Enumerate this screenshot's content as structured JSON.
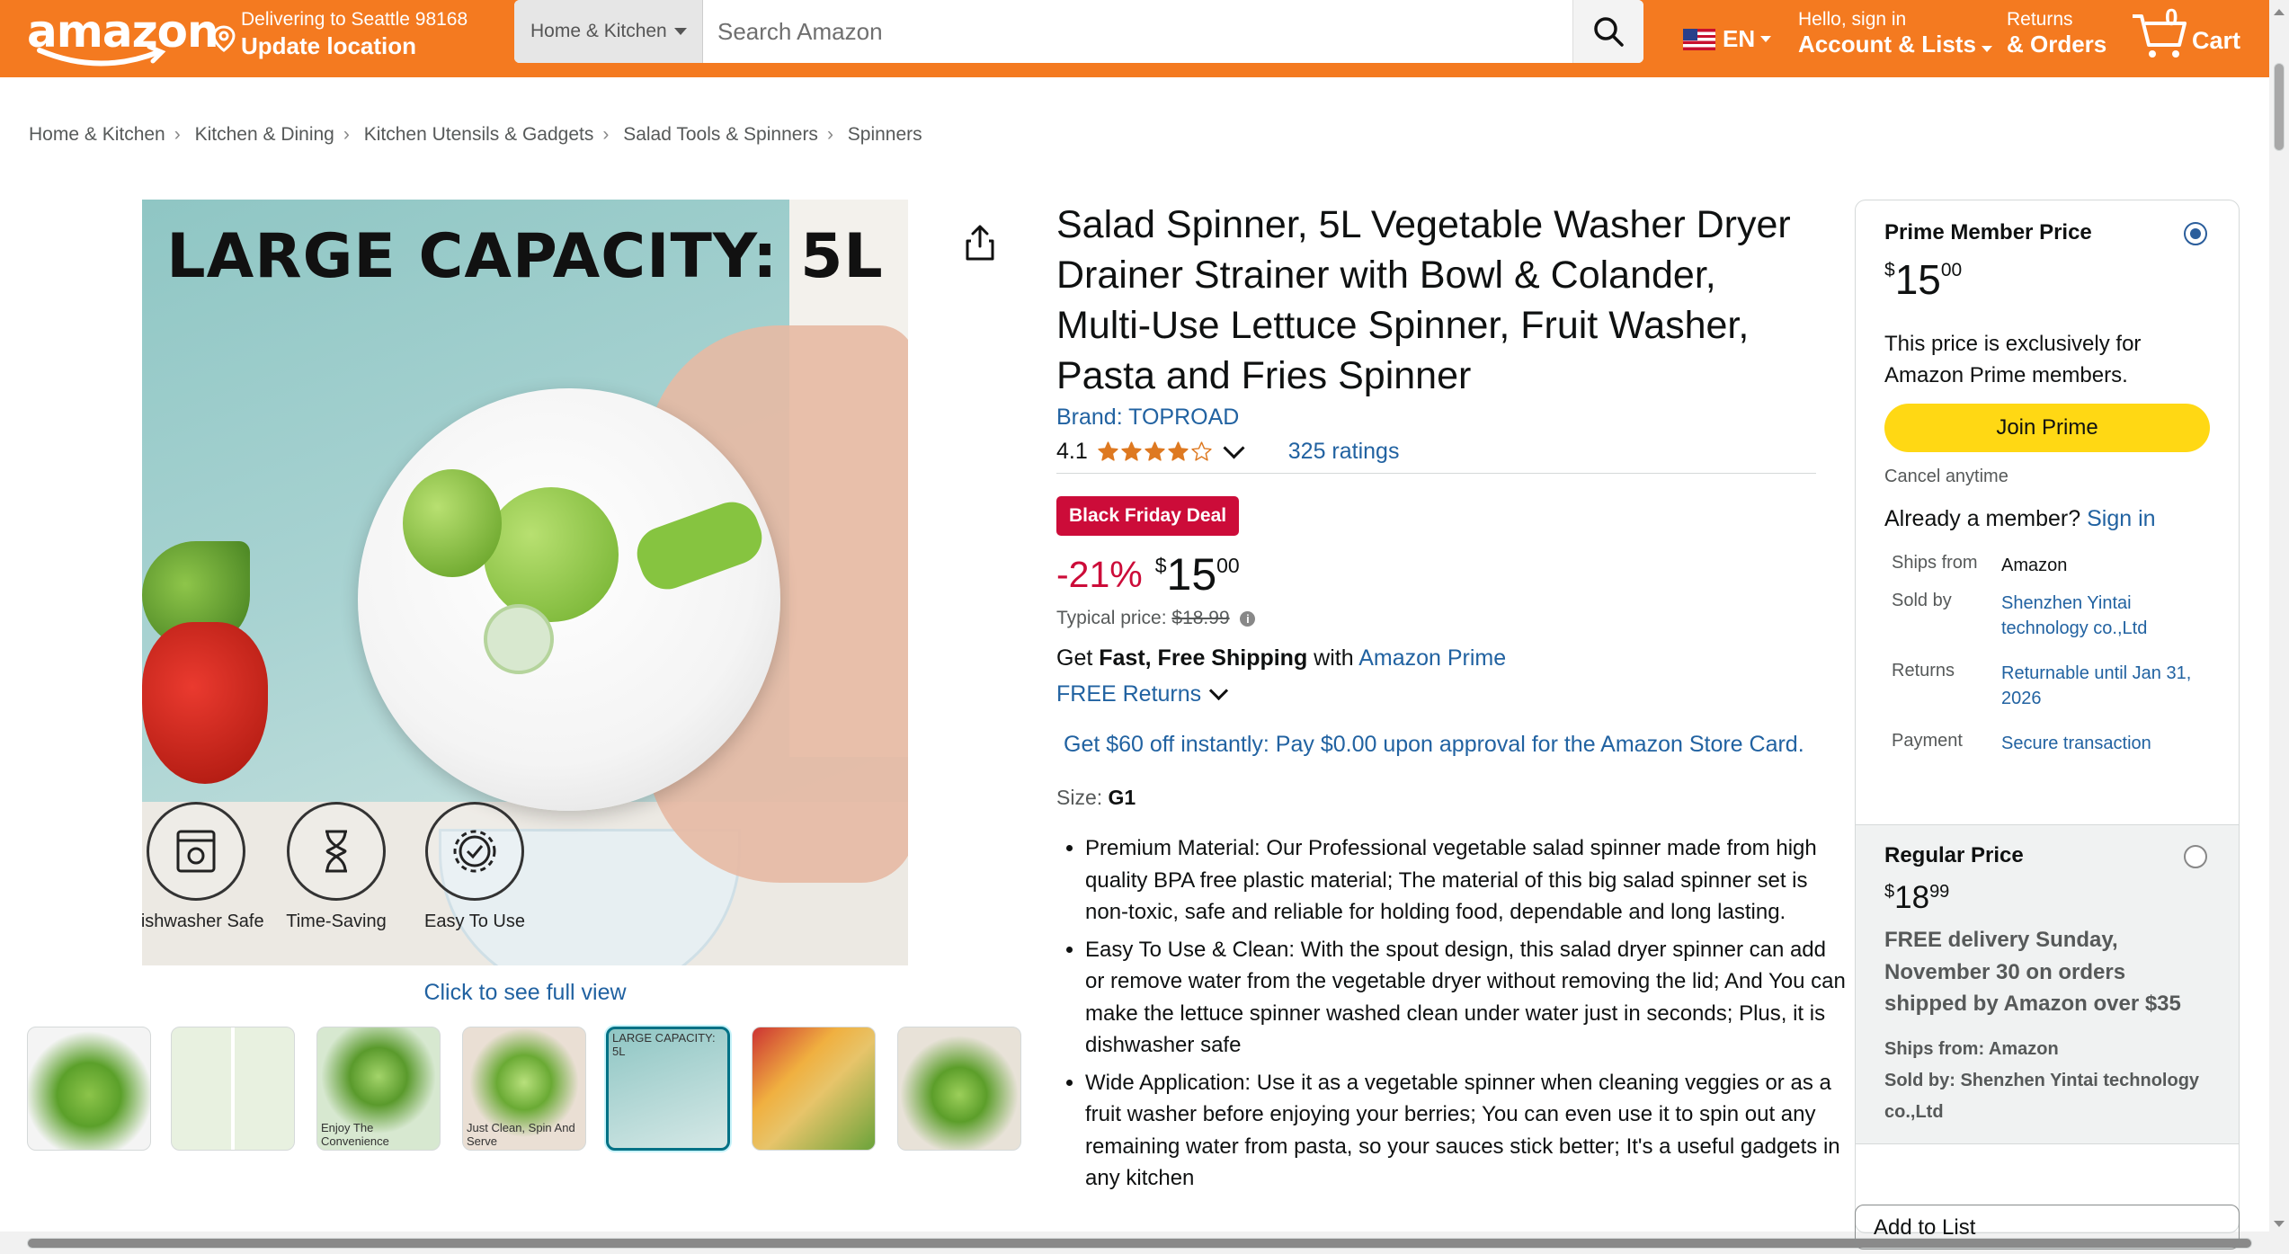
{
  "nav": {
    "logo": "amazon",
    "deliver_line1": "Delivering to Seattle 98168",
    "deliver_line2": "Update location",
    "search_category": "Home & Kitchen",
    "search_placeholder": "Search Amazon",
    "language": "EN",
    "account_line1": "Hello, sign in",
    "account_line2": "Account & Lists",
    "returns_line1": "Returns",
    "returns_line2": "& Orders",
    "cart_count": "0",
    "cart_label": "Cart",
    "accent": "#f47a20"
  },
  "breadcrumbs": [
    "Home & Kitchen",
    "Kitchen & Dining",
    "Kitchen Utensils & Gadgets",
    "Salad Tools & Spinners",
    "Spinners"
  ],
  "gallery": {
    "headline": "LARGE CAPACITY: 5L",
    "badges": [
      "Dishwasher Safe",
      "Time-Saving",
      "Easy To Use"
    ],
    "full_view": "Click to see full view",
    "thumb_captions": [
      "",
      "",
      "Enjoy The Convenience",
      "Just Clean, Spin And Serve",
      "LARGE CAPACITY: 5L",
      "",
      ""
    ],
    "selected_thumb": 4
  },
  "product": {
    "title": "Salad Spinner, 5L Vegetable Washer Dryer Drainer Strainer with Bowl & Colander, Multi-Use Lettuce Spinner, Fruit Washer, Pasta and Fries Spinner",
    "brand": "Brand: TOPROAD",
    "rating": "4.1",
    "rating_value": 4.1,
    "ratings_count": "325 ratings",
    "deal_badge": "Black Friday Deal",
    "discount": "-21%",
    "currency": "$",
    "price_whole": "15",
    "price_fraction": "00",
    "typical_label": "Typical price:",
    "typical_price": "$18.99",
    "shipping_prefix": "Get ",
    "shipping_bold": "Fast, Free Shipping",
    "shipping_mid": " with ",
    "shipping_link": "Amazon Prime",
    "free_returns": "FREE Returns",
    "promo": "Get $60 off instantly: Pay $0.00 upon approval for the Amazon Store Card.",
    "size_label": "Size: ",
    "size_value": "G1",
    "bullets": [
      "Premium Material: Our Professional vegetable salad spinner made from high quality BPA free plastic material; The material of this big salad spinner set is non-toxic, safe and reliable for holding food, dependable and long lasting.",
      "Easy To Use & Clean: With the spout design, this salad dryer spinner can add or remove water from the vegetable dryer without removing the lid; And You can make the lettuce spinner washed clean under water just in seconds; Plus, it is dishwasher safe",
      "Wide Application: Use it as a vegetable spinner when cleaning veggies or as a fruit washer before enjoying your berries; You can even use it to spin out any remaining water from pasta, so your sauces stick better; It's a useful gadgets in any kitchen"
    ]
  },
  "buybox": {
    "prime_title": "Prime Member Price",
    "prime_currency": "$",
    "prime_whole": "15",
    "prime_fraction": "00",
    "prime_exclusive": "This price is exclusively for Amazon Prime members.",
    "join_button": "Join Prime",
    "cancel": "Cancel anytime",
    "already_text": "Already a member? ",
    "sign_in": "Sign in",
    "info": [
      {
        "k": "Ships from",
        "v": "Amazon"
      },
      {
        "k": "Sold by",
        "v": "Shenzhen Yintai technology co.,Ltd"
      },
      {
        "k": "Returns",
        "v": "Returnable until Jan 31, 2026"
      },
      {
        "k": "Payment",
        "v": "Secure transaction"
      }
    ],
    "regular_title": "Regular Price",
    "regular_currency": "$",
    "regular_whole": "18",
    "regular_fraction": "99",
    "regular_delivery": "FREE delivery Sunday, November 30 on orders shipped by Amazon over $35",
    "regular_ships": "Ships from: Amazon",
    "regular_sold": "Sold by: Shenzhen Yintai technology co.,Ltd",
    "add_to_list": "Add to List"
  }
}
